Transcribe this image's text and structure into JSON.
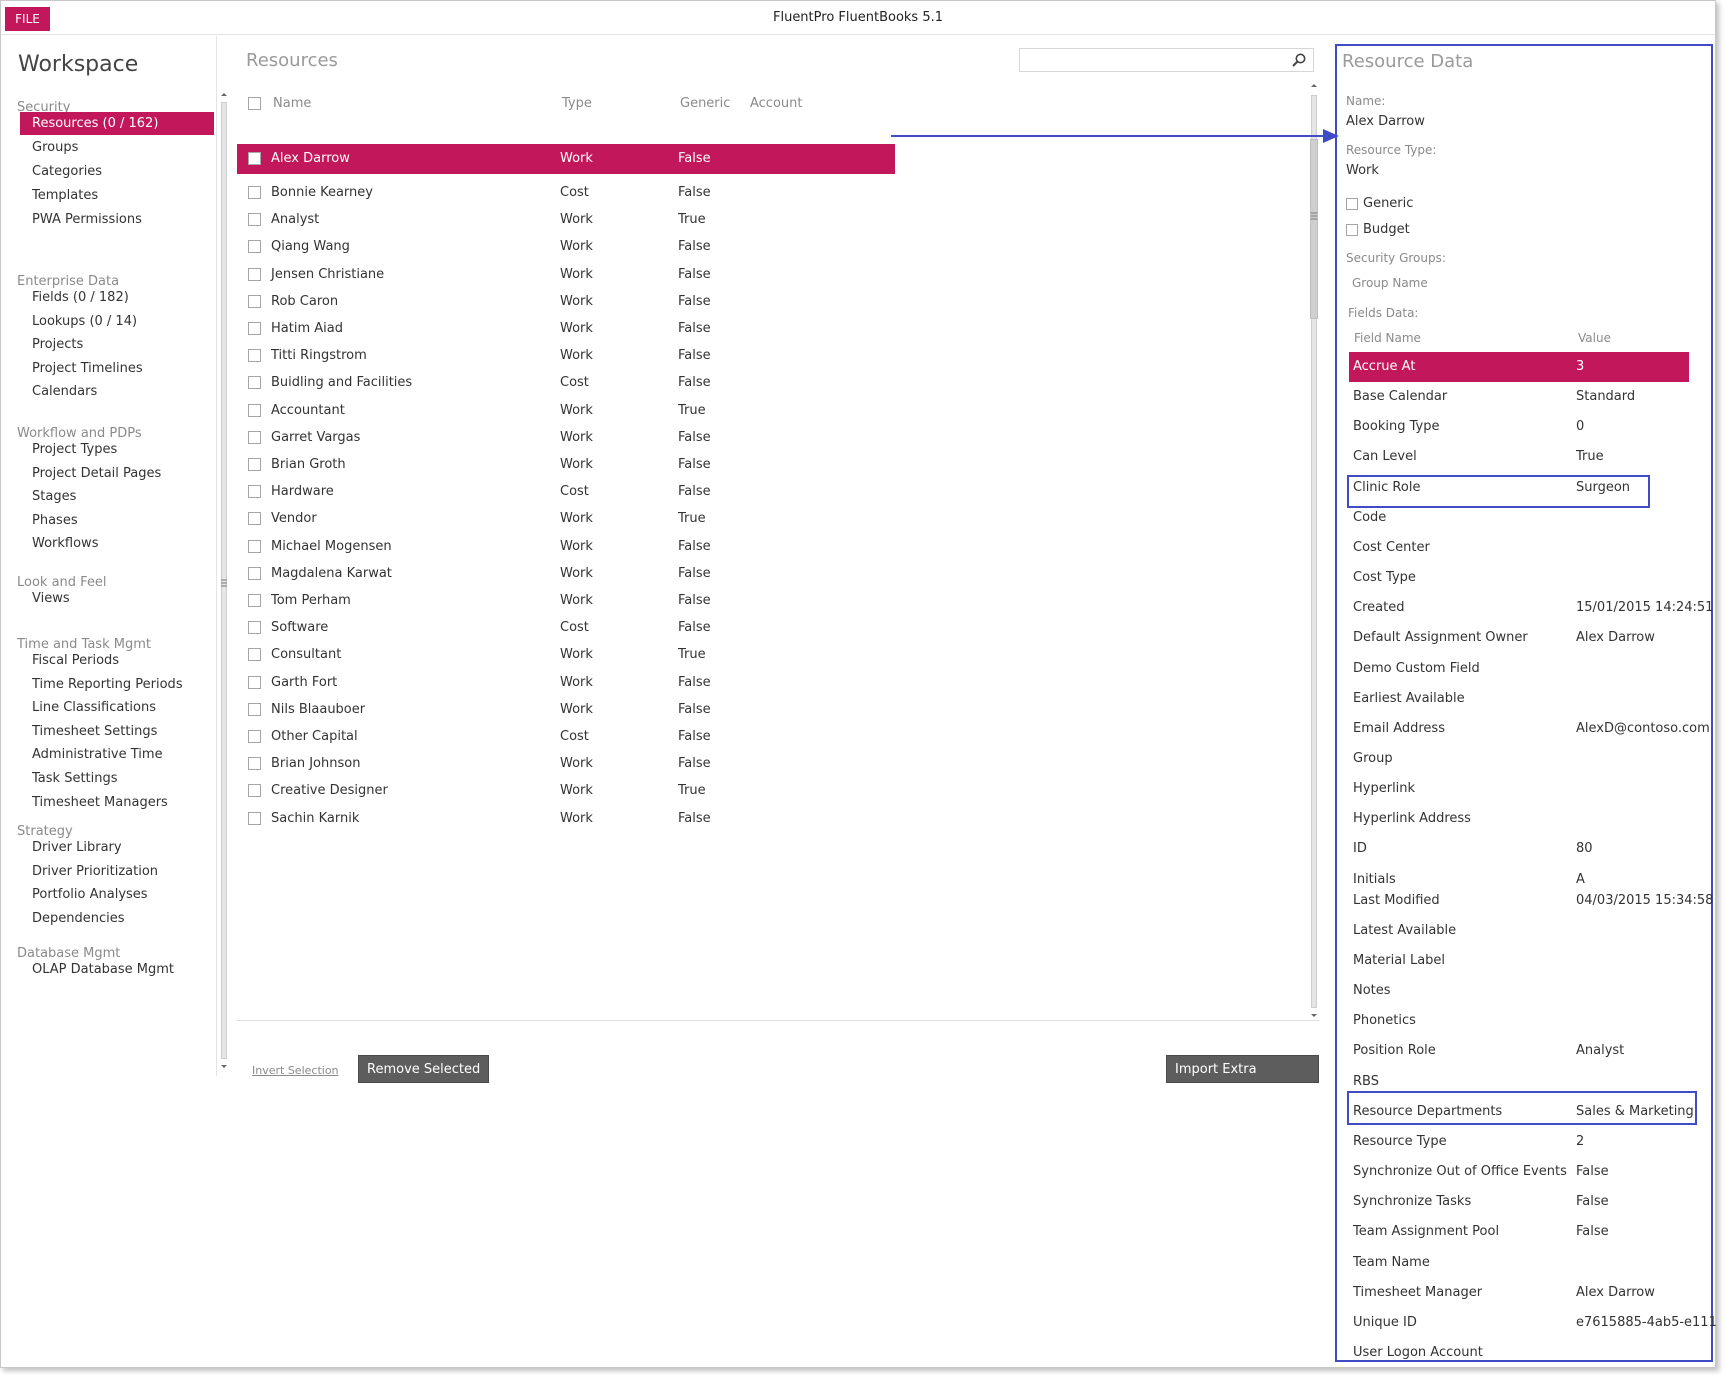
{
  "titlebar": {
    "file_label": "FILE",
    "app_title": "FluentPro FluentBooks 5.1"
  },
  "sidebar": {
    "title": "Workspace",
    "sections": [
      {
        "label": "Security",
        "items": [
          "Resources (0 / 162)",
          "Groups",
          "Categories",
          "Templates",
          "PWA Permissions"
        ]
      },
      {
        "label": "Enterprise Data",
        "items": [
          "Fields (0 / 182)",
          "Lookups (0 / 14)",
          "Projects",
          "Project Timelines",
          "Calendars"
        ]
      },
      {
        "label": "Workflow and PDPs",
        "items": [
          "Project Types",
          "Project Detail Pages",
          "Stages",
          "Phases",
          "Workflows"
        ]
      },
      {
        "label": "Look and Feel",
        "items": [
          "Views"
        ]
      },
      {
        "label": "Time and Task Mgmt",
        "items": [
          "Fiscal Periods",
          "Time Reporting Periods",
          "Line Classifications",
          "Timesheet Settings",
          "Administrative Time",
          "Task Settings",
          "Timesheet Managers"
        ]
      },
      {
        "label": "Strategy",
        "items": [
          "Driver Library",
          "Driver Prioritization",
          "Portfolio Analyses",
          "Dependencies"
        ]
      },
      {
        "label": "Database Mgmt",
        "items": [
          "OLAP Database Mgmt"
        ]
      }
    ],
    "selected_item": "Resources (0 / 162)"
  },
  "resources": {
    "title": "Resources",
    "search_placeholder": "",
    "columns": {
      "name": "Name",
      "type": "Type",
      "generic": "Generic",
      "account": "Account"
    },
    "rows": [
      {
        "name": "Alex Darrow",
        "type": "Work",
        "generic": "False",
        "selected": true
      },
      {
        "name": "Bonnie Kearney",
        "type": "Cost",
        "generic": "False"
      },
      {
        "name": "Analyst",
        "type": "Work",
        "generic": "True"
      },
      {
        "name": "Qiang Wang",
        "type": "Work",
        "generic": "False"
      },
      {
        "name": "Jensen Christiane",
        "type": "Work",
        "generic": "False"
      },
      {
        "name": "Rob Caron",
        "type": "Work",
        "generic": "False"
      },
      {
        "name": "Hatim Aiad",
        "type": "Work",
        "generic": "False"
      },
      {
        "name": "Titti Ringstrom",
        "type": "Work",
        "generic": "False"
      },
      {
        "name": "Buidling and Facilities",
        "type": "Cost",
        "generic": "False"
      },
      {
        "name": "Accountant",
        "type": "Work",
        "generic": "True"
      },
      {
        "name": "Garret Vargas",
        "type": "Work",
        "generic": "False"
      },
      {
        "name": "Brian Groth",
        "type": "Work",
        "generic": "False"
      },
      {
        "name": "Hardware",
        "type": "Cost",
        "generic": "False"
      },
      {
        "name": "Vendor",
        "type": "Work",
        "generic": "True"
      },
      {
        "name": "Michael Mogensen",
        "type": "Work",
        "generic": "False"
      },
      {
        "name": "Magdalena Karwat",
        "type": "Work",
        "generic": "False"
      },
      {
        "name": "Tom Perham",
        "type": "Work",
        "generic": "False"
      },
      {
        "name": "Software",
        "type": "Cost",
        "generic": "False"
      },
      {
        "name": "Consultant",
        "type": "Work",
        "generic": "True"
      },
      {
        "name": "Garth Fort",
        "type": "Work",
        "generic": "False"
      },
      {
        "name": "Nils Blaauboer",
        "type": "Work",
        "generic": "False"
      },
      {
        "name": "Other Capital",
        "type": "Cost",
        "generic": "False"
      },
      {
        "name": "Brian Johnson",
        "type": "Work",
        "generic": "False"
      },
      {
        "name": "Creative Designer",
        "type": "Work",
        "generic": "True"
      },
      {
        "name": "Sachin Karnik",
        "type": "Work",
        "generic": "False"
      }
    ],
    "invert_selection_label": "Invert Selection",
    "remove_selected_label": "Remove Selected",
    "import_extra_label": "Import Extra Resources"
  },
  "resource_data": {
    "title": "Resource Data",
    "name_label": "Name:",
    "name_value": "Alex Darrow",
    "type_label": "Resource Type:",
    "type_value": "Work",
    "generic_label": "Generic",
    "budget_label": "Budget",
    "security_groups_label": "Security Groups:",
    "group_name_header": "Group Name",
    "fields_data_label": "Fields Data:",
    "field_name_header": "Field Name",
    "value_header": "Value",
    "fields": [
      {
        "name": "Accrue At",
        "value": "3"
      },
      {
        "name": "Base Calendar",
        "value": "Standard"
      },
      {
        "name": "Booking Type",
        "value": "0"
      },
      {
        "name": "Can Level",
        "value": "True"
      },
      {
        "name": "Clinic Role",
        "value": "Surgeon"
      },
      {
        "name": "Code",
        "value": ""
      },
      {
        "name": "Cost Center",
        "value": ""
      },
      {
        "name": "Cost Type",
        "value": ""
      },
      {
        "name": "Created",
        "value": "15/01/2015 14:24:51"
      },
      {
        "name": "Default Assignment Owner",
        "value": "Alex Darrow"
      },
      {
        "name": "Demo Custom Field",
        "value": ""
      },
      {
        "name": "Earliest Available",
        "value": ""
      },
      {
        "name": "Email Address",
        "value": "AlexD@contoso.com"
      },
      {
        "name": "Group",
        "value": ""
      },
      {
        "name": "Hyperlink",
        "value": ""
      },
      {
        "name": "Hyperlink Address",
        "value": ""
      },
      {
        "name": "ID",
        "value": "80"
      },
      {
        "name": "Initials",
        "value": "A"
      },
      {
        "name": "Last Modified",
        "value": "04/03/2015 15:34:58"
      },
      {
        "name": "Latest Available",
        "value": ""
      },
      {
        "name": "Material Label",
        "value": ""
      },
      {
        "name": "Notes",
        "value": ""
      },
      {
        "name": "Phonetics",
        "value": ""
      },
      {
        "name": "Position Role",
        "value": "Analyst"
      },
      {
        "name": "RBS",
        "value": ""
      },
      {
        "name": "Resource Departments",
        "value": "Sales & Marketing"
      },
      {
        "name": "Resource Type",
        "value": "2"
      },
      {
        "name": "Synchronize Out of Office Events",
        "value": "False"
      },
      {
        "name": "Synchronize Tasks",
        "value": "False"
      },
      {
        "name": "Team Assignment Pool",
        "value": "False"
      },
      {
        "name": "Team Name",
        "value": ""
      },
      {
        "name": "Timesheet Manager",
        "value": "Alex Darrow"
      },
      {
        "name": "Unique ID",
        "value": "e7615885-4ab5-e111"
      },
      {
        "name": "User Logon Account",
        "value": ""
      }
    ]
  },
  "colors": {
    "accent": "#c2185b",
    "highlight_box": "#3f4cc4",
    "button_dark": "#5d5d5d"
  }
}
